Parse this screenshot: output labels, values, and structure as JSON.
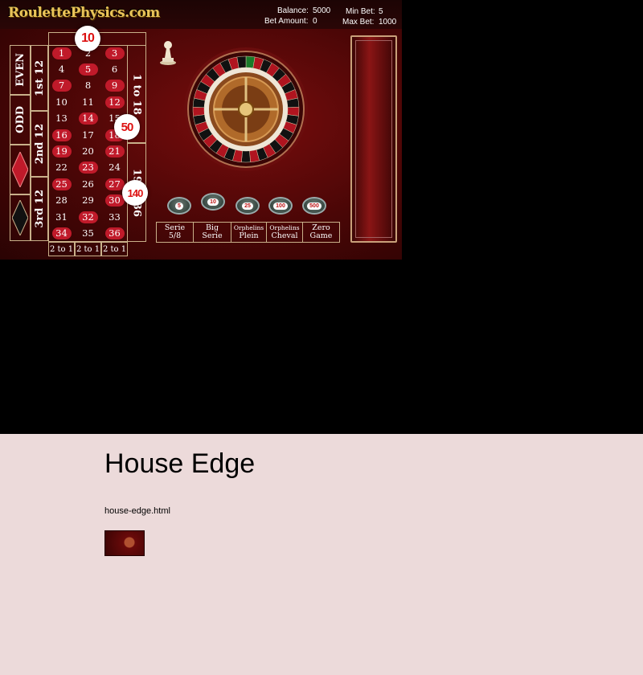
{
  "game": {
    "logo": "RoulettePhysics.com",
    "balance_label": "Balance:",
    "balance_value": "5000",
    "bet_amount_label": "Bet Amount:",
    "bet_amount_value": "0",
    "min_bet_label": "Min Bet:",
    "min_bet_value": "5",
    "max_bet_label": "Max Bet:",
    "max_bet_value": "1000",
    "outside_bets": {
      "even": "EVEN",
      "odd": "ODD",
      "first12": "1st 12",
      "second12": "2nd 12",
      "third12": "3rd 12",
      "low": "1 to 18",
      "high": "19 to 36",
      "column": "2 to 1"
    },
    "numbers": [
      {
        "n": "1",
        "c": "red"
      },
      {
        "n": "2",
        "c": "black"
      },
      {
        "n": "3",
        "c": "red"
      },
      {
        "n": "4",
        "c": "black"
      },
      {
        "n": "5",
        "c": "red"
      },
      {
        "n": "6",
        "c": "black"
      },
      {
        "n": "7",
        "c": "red"
      },
      {
        "n": "8",
        "c": "black"
      },
      {
        "n": "9",
        "c": "red"
      },
      {
        "n": "10",
        "c": "black"
      },
      {
        "n": "11",
        "c": "black"
      },
      {
        "n": "12",
        "c": "red"
      },
      {
        "n": "13",
        "c": "black"
      },
      {
        "n": "14",
        "c": "red"
      },
      {
        "n": "15",
        "c": "black"
      },
      {
        "n": "16",
        "c": "red"
      },
      {
        "n": "17",
        "c": "black"
      },
      {
        "n": "18",
        "c": "red"
      },
      {
        "n": "19",
        "c": "red"
      },
      {
        "n": "20",
        "c": "black"
      },
      {
        "n": "21",
        "c": "red"
      },
      {
        "n": "22",
        "c": "black"
      },
      {
        "n": "23",
        "c": "red"
      },
      {
        "n": "24",
        "c": "black"
      },
      {
        "n": "25",
        "c": "red"
      },
      {
        "n": "26",
        "c": "black"
      },
      {
        "n": "27",
        "c": "red"
      },
      {
        "n": "28",
        "c": "black"
      },
      {
        "n": "29",
        "c": "black"
      },
      {
        "n": "30",
        "c": "red"
      },
      {
        "n": "31",
        "c": "black"
      },
      {
        "n": "32",
        "c": "red"
      },
      {
        "n": "33",
        "c": "black"
      },
      {
        "n": "34",
        "c": "red"
      },
      {
        "n": "35",
        "c": "black"
      },
      {
        "n": "36",
        "c": "red"
      }
    ],
    "markers": [
      "10",
      "50",
      "140"
    ],
    "chips": [
      "5",
      "10",
      "25",
      "100",
      "500"
    ],
    "call_bets": [
      {
        "line1": "Serie",
        "line2": "5/8"
      },
      {
        "line1": "Big",
        "line2": "Serie"
      },
      {
        "line1": "Orphelins",
        "line2": "Plein"
      },
      {
        "line1": "Orphelins",
        "line2": "Cheval"
      },
      {
        "line1": "Zero",
        "line2": "Game"
      }
    ],
    "colors": {
      "red": "#c01a2a",
      "felt": "#4a0606",
      "gold": "#c9b08a"
    }
  },
  "content": {
    "title": "House Edge",
    "link_text": "house-edge.html"
  }
}
